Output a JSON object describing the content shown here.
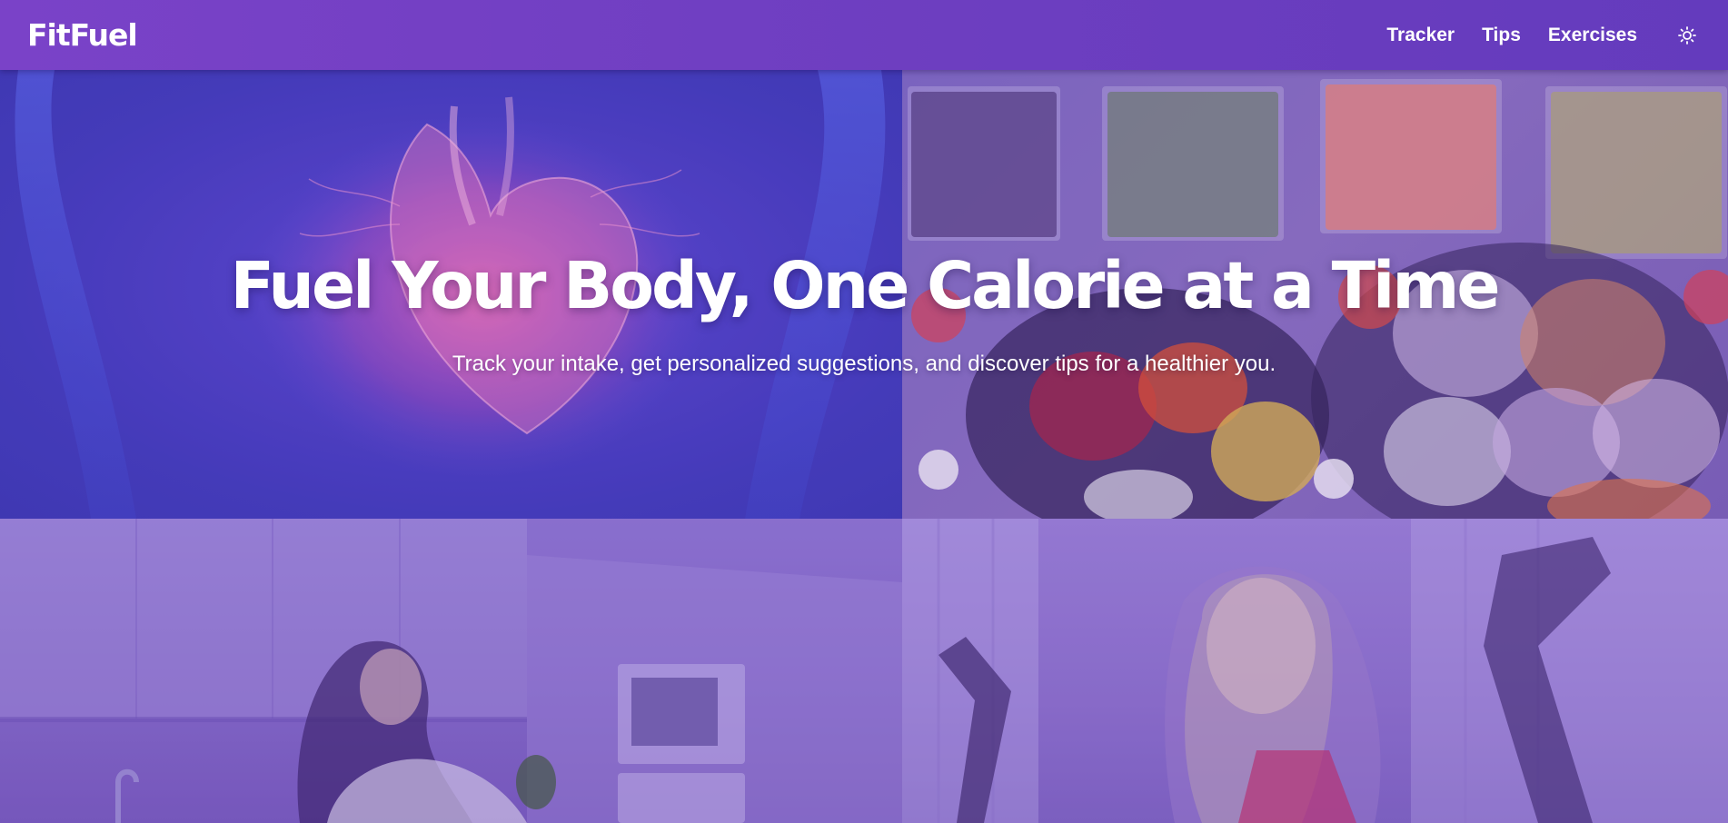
{
  "navbar": {
    "logo": "FitFuel",
    "links": [
      {
        "label": "Tracker"
      },
      {
        "label": "Tips"
      },
      {
        "label": "Exercises"
      }
    ],
    "theme_toggle_icon": "sun-icon"
  },
  "hero": {
    "title": "Fuel Your Body, One Calorie at a Time",
    "subtitle": "Track your intake, get personalized suggestions, and discover tips for a healthier you.",
    "images": [
      "heart-anatomy-image",
      "food-platter-image",
      "kitchen-woman-image",
      "workout-woman-image"
    ]
  },
  "colors": {
    "navbar": "#6d3ec0",
    "text": "#ffffff",
    "overlay": "#6e46c8"
  }
}
